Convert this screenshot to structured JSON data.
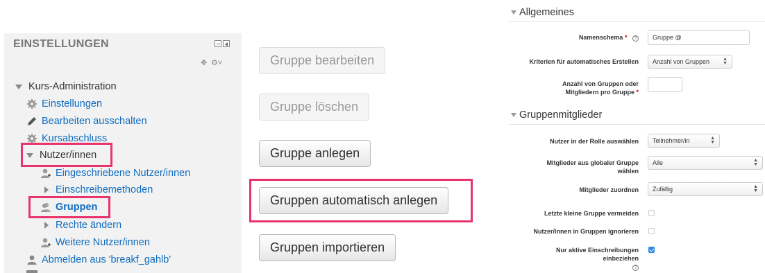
{
  "block": {
    "title": "EINSTELLUNGEN",
    "items": [
      {
        "label": "Kurs-Administration",
        "icon": "triangle-down-icon"
      },
      {
        "label": "Einstellungen",
        "icon": "gear-icon"
      },
      {
        "label": "Bearbeiten ausschalten",
        "icon": "pencil-icon"
      },
      {
        "label": "Kursabschluss",
        "icon": "gear-icon"
      },
      {
        "label": "Nutzer/innen",
        "icon": "triangle-down-icon"
      },
      {
        "label": "Eingeschriebene Nutzer/innen",
        "icon": "user-add-icon"
      },
      {
        "label": "Einschreibemethoden",
        "icon": "triangle-right-icon"
      },
      {
        "label": "Gruppen",
        "icon": "group-icon"
      },
      {
        "label": "Rechte ändern",
        "icon": "triangle-right-icon"
      },
      {
        "label": "Weitere Nutzer/innen",
        "icon": "user-add-icon"
      },
      {
        "label": "Abmelden aus 'breakf_gahlb'",
        "icon": "user-icon"
      }
    ]
  },
  "buttons": {
    "edit": "Gruppe bearbeiten",
    "delete": "Gruppe löschen",
    "create": "Gruppe anlegen",
    "auto_create": "Gruppen automatisch anlegen",
    "import": "Gruppen importieren"
  },
  "form": {
    "section_general": "Allgemeines",
    "naming_label": "Namenschema",
    "naming_value": "Gruppe @",
    "criteria_label": "Kriterien für automatisches Erstellen",
    "criteria_value": "Anzahl von Gruppen",
    "count_label_1": "Anzahl von Gruppen oder",
    "count_label_2": "Mitgliedern pro Gruppe",
    "count_value": "",
    "section_members": "Gruppenmitglieder",
    "role_label": "Nutzer in der Rolle auswählen",
    "role_value": "Teilnehmer/in",
    "global_label_1": "Mitglieder aus globaler Gruppe",
    "global_label_2": "wählen",
    "global_value": "Alle",
    "assign_label": "Mitglieder zuordnen",
    "assign_value": "Zufällig",
    "avoid_small_label": "Letzte kleine Gruppe vermeiden",
    "avoid_small_checked": false,
    "ignore_label": "Nutzer/innen in Gruppen ignorieren",
    "ignore_checked": false,
    "active_label_1": "Nur aktive Einschreibungen",
    "active_label_2": "einbeziehen",
    "active_checked": true,
    "required_marker": "*",
    "help_glyph": "?"
  },
  "colors": {
    "link": "#0f6cbf",
    "highlight": "#e8336b",
    "block_bg": "#f2f2f2",
    "checkbox_on": "#2f8ae6"
  }
}
